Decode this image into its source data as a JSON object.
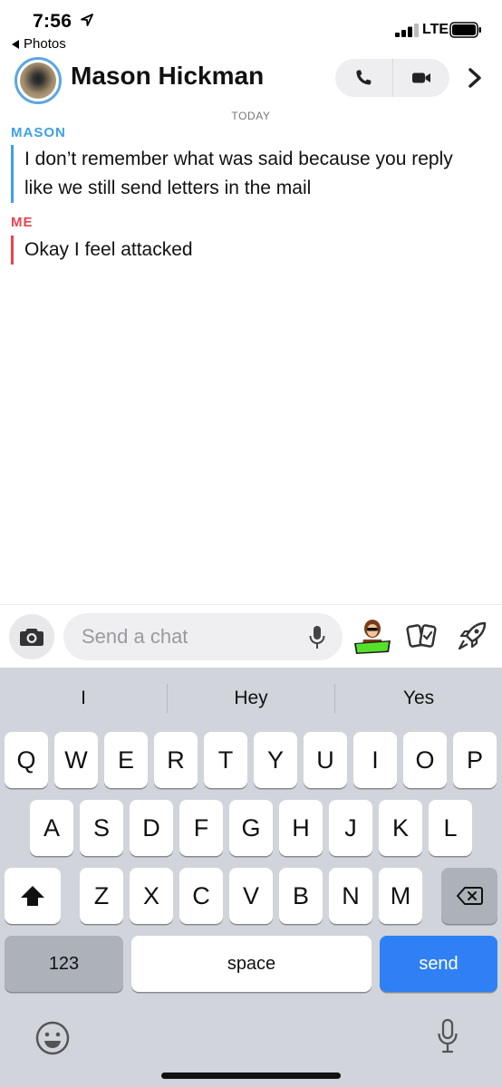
{
  "status_bar": {
    "time": "7:56",
    "back_app": "Photos",
    "network": "LTE"
  },
  "header": {
    "contact_name": "Mason Hickman"
  },
  "chat": {
    "date_label": "TODAY",
    "messages": [
      {
        "sender": "MASON",
        "text": "I don’t remember what was said because you reply like we still send letters in the mail"
      },
      {
        "sender": "ME",
        "text": "Okay I feel attacked"
      }
    ]
  },
  "input": {
    "placeholder": "Send a chat"
  },
  "colors": {
    "mason": "#3ea0e8",
    "me": "#e8454f",
    "send_key": "#2f80f5"
  },
  "keyboard": {
    "suggestions": [
      "I",
      "Hey",
      "Yes"
    ],
    "row1": [
      "Q",
      "W",
      "E",
      "R",
      "T",
      "Y",
      "U",
      "I",
      "O",
      "P"
    ],
    "row2": [
      "A",
      "S",
      "D",
      "F",
      "G",
      "H",
      "J",
      "K",
      "L"
    ],
    "row3": [
      "Z",
      "X",
      "C",
      "V",
      "B",
      "N",
      "M"
    ],
    "numbers_key": "123",
    "space_key": "space",
    "send_key": "send"
  },
  "icons": {
    "location": "location-arrow-icon",
    "phone": "phone-icon",
    "video": "video-camera-icon",
    "camera": "camera-icon",
    "mic": "microphone-icon",
    "bitmoji": "bitmoji-sticker-icon",
    "cards": "cards-icon",
    "rocket": "rocket-icon",
    "shift": "shift-icon",
    "backspace": "backspace-icon",
    "emoji": "emoji-icon",
    "dictation": "dictation-mic-icon"
  }
}
